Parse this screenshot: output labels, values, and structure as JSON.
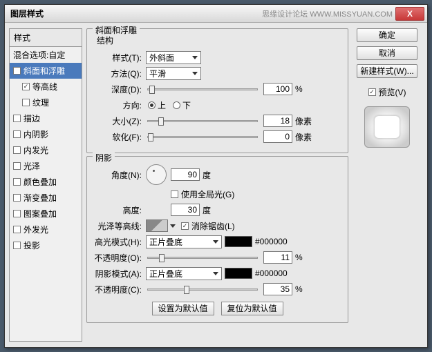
{
  "title": "图层样式",
  "watermark": "思缘设计论坛 WWW.MISSYUAN.COM",
  "left": {
    "head": "样式",
    "blend": "混合选项:自定",
    "items": [
      {
        "label": "斜面和浮雕",
        "on": true,
        "sel": true,
        "sub": false
      },
      {
        "label": "等高线",
        "on": true,
        "sel": false,
        "sub": true
      },
      {
        "label": "纹理",
        "on": false,
        "sel": false,
        "sub": true
      },
      {
        "label": "描边",
        "on": false,
        "sel": false,
        "sub": false
      },
      {
        "label": "内阴影",
        "on": false,
        "sel": false,
        "sub": false
      },
      {
        "label": "内发光",
        "on": false,
        "sel": false,
        "sub": false
      },
      {
        "label": "光泽",
        "on": false,
        "sel": false,
        "sub": false
      },
      {
        "label": "颜色叠加",
        "on": false,
        "sel": false,
        "sub": false
      },
      {
        "label": "渐变叠加",
        "on": false,
        "sel": false,
        "sub": false
      },
      {
        "label": "图案叠加",
        "on": false,
        "sel": false,
        "sub": false
      },
      {
        "label": "外发光",
        "on": false,
        "sel": false,
        "sub": false
      },
      {
        "label": "投影",
        "on": false,
        "sel": false,
        "sub": false
      }
    ]
  },
  "group1": {
    "title": "斜面和浮雕",
    "sub": "结构",
    "style_l": "样式(T):",
    "style_v": "外斜面",
    "tech_l": "方法(Q):",
    "tech_v": "平滑",
    "depth_l": "深度(D):",
    "depth_v": "100",
    "pct": "%",
    "dir_l": "方向:",
    "up": "上",
    "down": "下",
    "size_l": "大小(Z):",
    "size_v": "18",
    "px": "像素",
    "soft_l": "软化(F):",
    "soft_v": "0"
  },
  "group2": {
    "title": "阴影",
    "angle_l": "角度(N):",
    "angle_v": "90",
    "deg": "度",
    "global_l": "使用全局光(G)",
    "alt_l": "高度:",
    "alt_v": "30",
    "gloss_l": "光泽等高线:",
    "aa_l": "消除锯齿(L)",
    "hmode_l": "高光模式(H):",
    "hmode_v": "正片叠底",
    "hex1": "#000000",
    "hop_l": "不透明度(O):",
    "hop_v": "11",
    "smode_l": "阴影模式(A):",
    "smode_v": "正片叠底",
    "hex2": "#000000",
    "sop_l": "不透明度(C):",
    "sop_v": "35",
    "def1": "设置为默认值",
    "def2": "复位为默认值"
  },
  "right": {
    "ok": "确定",
    "cancel": "取消",
    "new": "新建样式(W)...",
    "preview": "预览(V)"
  }
}
